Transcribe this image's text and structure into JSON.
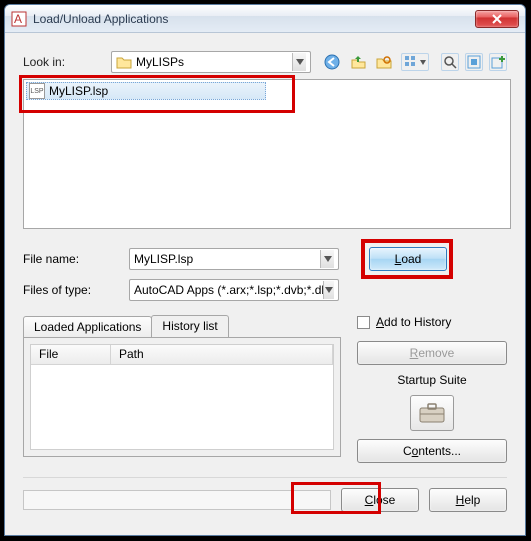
{
  "title": "Load/Unload Applications",
  "look_in_label": "Look in:",
  "look_in_value": "MyLISPs",
  "file_list": [
    {
      "name": "MyLISP.lsp"
    }
  ],
  "filename_label": "File name:",
  "filename_value": "MyLISP.lsp",
  "filetype_label": "Files of type:",
  "filetype_value": "AutoCAD Apps (*.arx;*.lsp;*.dvb;*.dbx;*.vlx;*.",
  "load_btn": "Load",
  "tabs": {
    "loaded": "Loaded Applications",
    "history": "History list"
  },
  "grid_cols": {
    "file": "File",
    "path": "Path"
  },
  "add_history": "Add to History",
  "remove_btn": "Remove",
  "startup_suite": "Startup Suite",
  "contents_btn": "Contents...",
  "close_btn": "Close",
  "help_btn": "Help"
}
